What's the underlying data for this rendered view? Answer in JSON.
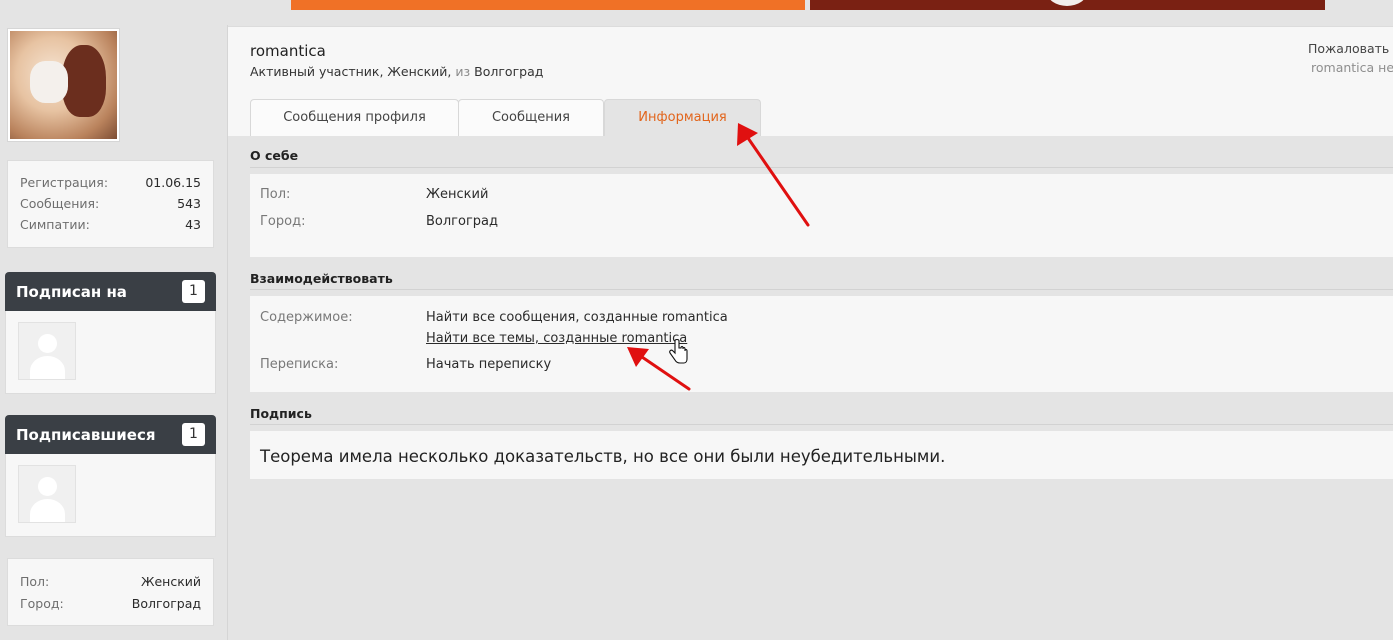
{
  "user": {
    "name": "romantica",
    "title": "Активный участник",
    "gender": "Женский",
    "from_word": "из",
    "city": "Волгоград"
  },
  "header_actions": {
    "report_label": "Пожаловать",
    "report_sub": "romantica не"
  },
  "stats": [
    {
      "label": "Регистрация:",
      "value": "01.06.15"
    },
    {
      "label": "Сообщения:",
      "value": "543"
    },
    {
      "label": "Симпатии:",
      "value": "43"
    }
  ],
  "following": {
    "title": "Подписан на",
    "count": "1"
  },
  "followers": {
    "title": "Подписавшиеся",
    "count": "1"
  },
  "sidebar_info": [
    {
      "label": "Пол:",
      "value": "Женский"
    },
    {
      "label": "Город:",
      "value": "Волгоград"
    }
  ],
  "tabs": [
    {
      "label": "Сообщения профиля",
      "active": false
    },
    {
      "label": "Сообщения",
      "active": false
    },
    {
      "label": "Информация",
      "active": true
    }
  ],
  "about": {
    "title": "О себе",
    "rows": [
      {
        "label": "Пол:",
        "value": "Женский"
      },
      {
        "label": "Город:",
        "value": "Волгоград"
      }
    ]
  },
  "interact": {
    "title": "Взаимодействовать",
    "content_label": "Содержимое:",
    "find_posts": "Найти все сообщения, созданные romantica",
    "find_threads": "Найти все темы, созданные romantica",
    "conversation_label": "Переписка:",
    "start_conversation": "Начать переписку"
  },
  "signature": {
    "title": "Подпись",
    "text": "Теорема имела несколько доказательств, но все они были неубедительными."
  },
  "colors": {
    "accent": "#e2651c",
    "banner_orange": "#f07126",
    "banner_dark": "#7a2113",
    "sidebar_head": "#3a3f45",
    "annotation_arrow": "#e01010"
  },
  "icons": [
    "avatar-photo",
    "default-user-icon",
    "hand-pointer-icon",
    "red-arrow-annotation"
  ]
}
